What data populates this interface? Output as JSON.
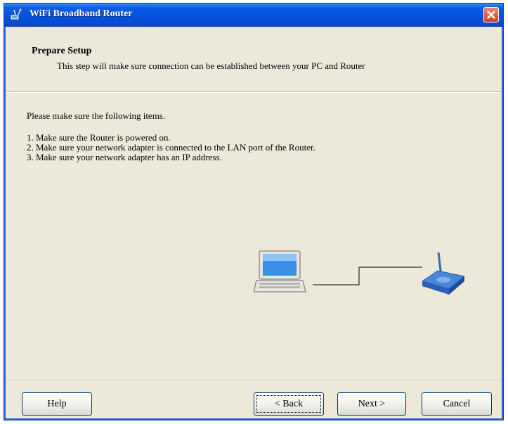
{
  "window": {
    "title": "WiFi Broadband Router",
    "title_icon": "router-app-icon",
    "close_icon": "close-icon"
  },
  "header": {
    "title": "Prepare Setup",
    "subtitle": "This step will make sure connection can be established between your PC and Router"
  },
  "body": {
    "intro": "Please make sure the following items.",
    "steps": [
      "1. Make sure the Router is powered on.",
      "2. Make sure your network adapter is connected to the LAN port of the Router.",
      "3. Make sure your network adapter has an IP address."
    ]
  },
  "diagram": {
    "pc_icon": "computer-icon",
    "router_icon": "router-icon"
  },
  "buttons": {
    "help": "Help",
    "back": "< Back",
    "next": "Next >",
    "cancel": "Cancel"
  }
}
